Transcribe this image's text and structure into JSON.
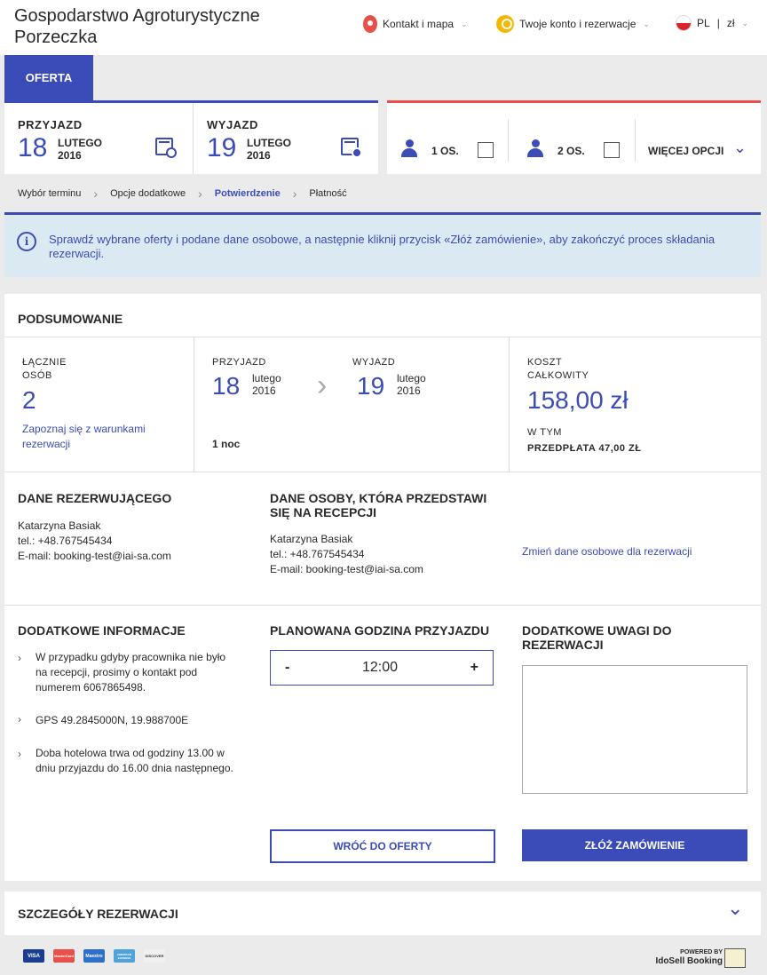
{
  "header": {
    "logo": "Gospodarstwo Agroturystyczne Porzeczka",
    "contact": "Kontakt i mapa",
    "account": "Twoje konto i rezerwacje",
    "lang": "PL",
    "separator": "|",
    "currency": "zł"
  },
  "tab_label": "OFERTA",
  "search": {
    "arrival": {
      "label": "PRZYJAZD",
      "day": "18",
      "month": "LUTEGO",
      "year": "2016"
    },
    "departure": {
      "label": "WYJAZD",
      "day": "19",
      "month": "LUTEGO",
      "year": "2016"
    },
    "persons": [
      {
        "label": "1 OS."
      },
      {
        "label": "2 OS."
      }
    ],
    "more_options": "WIĘCEJ OPCJI"
  },
  "breadcrumb": [
    "Wybór terminu",
    "Opcje dodatkowe",
    "Potwierdzenie",
    "Płatność"
  ],
  "info_message": "Sprawdź wybrane oferty i podane dane osobowe, a następnie kliknij przycisk «Złóż zamówienie», aby zakończyć proces składania rezerwacji.",
  "summary": {
    "title": "PODSUMOWANIE",
    "persons_label_1": "ŁĄCZNIE",
    "persons_label_2": "OSÓB",
    "persons_count": "2",
    "terms_link_1": "Zapoznaj się z warunkami",
    "terms_link_2": "rezerwacji",
    "arrival_label": "PRZYJAZD",
    "arrival_day": "18",
    "arrival_month": "lutego",
    "arrival_year": "2016",
    "departure_label": "WYJAZD",
    "departure_day": "19",
    "departure_month": "lutego",
    "departure_year": "2016",
    "nights": "1 noc",
    "cost_label_1": "KOSZT",
    "cost_label_2": "CAŁKOWITY",
    "cost_value": "158,00 zł",
    "including": "W TYM",
    "prepayment": "PRZEDPŁATA 47,00 ZŁ"
  },
  "booker": {
    "title": "DANE REZERWUJĄCEGO",
    "name": "Katarzyna Basiak",
    "phone": "tel.: +48.767545434",
    "email": "E-mail: booking-test@iai-sa.com"
  },
  "guest": {
    "title_1": "DANE OSOBY, KTÓRA PRZEDSTAWI",
    "title_2": "SIĘ NA RECEPCJI",
    "name": "Katarzyna Basiak",
    "phone": "tel.: +48.767545434",
    "email": "E-mail: booking-test@iai-sa.com"
  },
  "change_link": "Zmień dane osobowe dla rezerwacji",
  "additional_info": {
    "title": "DODATKOWE INFORMACJE",
    "items": [
      [
        "W przypadku gdyby pracownika nie było",
        "na recepcji, prosimy o kontakt pod",
        "numerem 6067865498."
      ],
      [
        "GPS 49.2845000N, 19.988700E"
      ],
      [
        "Doba hotelowa trwa od godziny 13.00 w",
        "dniu przyjazdu do 16.00 dnia następnego."
      ]
    ]
  },
  "arrival_time": {
    "title": "PLANOWANA GODZINA PRZYJAZDU",
    "minus": "-",
    "value": "12:00",
    "plus": "+"
  },
  "notes": {
    "title_1": "DODATKOWE UWAGI DO",
    "title_2": "REZERWACJI"
  },
  "buttons": {
    "back": "WRÓĆ DO OFERTY",
    "submit": "ZŁÓŻ ZAMÓWIENIE"
  },
  "details_title": "SZCZEGÓŁY REZERWACJI",
  "footer": {
    "cards": [
      "VISA",
      "MasterCard",
      "Maestro",
      "AMERICAN EXPRESS",
      "DISCOVER"
    ],
    "powered_1": "POWERED BY",
    "powered_2": "IdoSell Booking"
  },
  "colors": {
    "accent": "#3b4cb8",
    "red": "#e8504c",
    "info_bg": "#dbe9f3"
  }
}
